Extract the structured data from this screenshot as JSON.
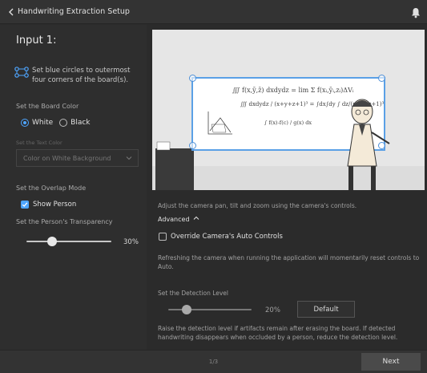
{
  "header": {
    "title": "Handwriting Extraction Setup"
  },
  "left": {
    "input_title": "Input 1:",
    "corner_instruction": "Set blue circles to outermost four corners of the board(s).",
    "board_color_label": "Set the Board Color",
    "board_color_options": [
      "White",
      "Black"
    ],
    "board_color_selected": "White",
    "text_color_label": "Set the Text Color",
    "text_color_value": "Color on White Background",
    "overlap_label": "Set the Overlap Mode",
    "show_person_label": "Show Person",
    "show_person_checked": true,
    "transparency_label": "Set the Person's Transparency",
    "transparency_value": "30%"
  },
  "right": {
    "camera_instruction": "Adjust the camera pan, tilt and zoom using the camera's controls.",
    "advanced_label": "Advanced",
    "override_label": "Override Camera's Auto Controls",
    "override_checked": false,
    "refresh_note": "Refreshing the camera when running the application will momentarily reset controls to Auto.",
    "detection_label": "Set the Detection Level",
    "detection_value": "20%",
    "default_button": "Default",
    "detection_note": "Raise the detection level if artifacts remain after erasing the board. If detected handwriting disappears when occluded by a person, reduce the detection level."
  },
  "footer": {
    "page_indicator": "1/3",
    "next_button": "Next"
  },
  "colors": {
    "accent": "#4ea5ff",
    "handle": "#4e90d8",
    "background": "#2b2b2b"
  }
}
